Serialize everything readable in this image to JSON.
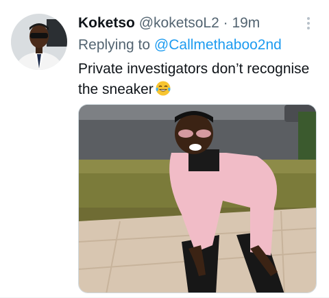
{
  "tweet": {
    "author_name": "Koketso",
    "author_handle": "@koketsoL2",
    "separator": "·",
    "time": "19m",
    "reply_prefix": "Replying to",
    "reply_to": "@Callmethaboo2nd",
    "text": "Private investigators don’t recognise the sneaker",
    "emoji": "face-with-tears-of-joy-icon"
  },
  "colors": {
    "link": "#1d9bf0",
    "secondary_text": "#536471",
    "primary_text": "#0f1419"
  },
  "icons": {
    "more": "more-vertical-icon",
    "avatar": "profile-avatar",
    "media": "attached-photo"
  }
}
